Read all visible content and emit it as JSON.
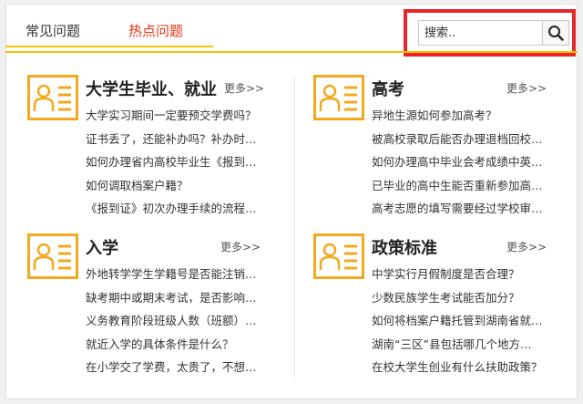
{
  "tabs": [
    {
      "label": "常见问题"
    },
    {
      "label": "热点问题"
    }
  ],
  "search": {
    "placeholder": "搜索.."
  },
  "more_label": "更多>>",
  "colors": {
    "accent_yellow": "#f5c400",
    "hot_red": "#e63212",
    "highlight_red": "#e8262a"
  },
  "sections": [
    {
      "title": "大学生毕业、就业",
      "items": [
        "大学实习期间一定要预交学费吗？",
        "证书丢了，还能补办吗？补办时…",
        "如何办理省内高校毕业生《报到…",
        "如何调取档案户籍？",
        "《报到证》初次办理手续的流程…"
      ]
    },
    {
      "title": "高考",
      "items": [
        "异地生源如何参加高考？",
        "被高校录取后能否办理退档回校…",
        "如何办理高中毕业会考成绩中英…",
        "已毕业的高中生能否重新参加高…",
        "高考志愿的填写需要经过学校审…"
      ]
    },
    {
      "title": "入学",
      "items": [
        "外地转学学生学籍号是否能注销…",
        "缺考期中或期末考试，是否影响…",
        "义务教育阶段班级人数（班额）…",
        "就近入学的具体条件是什么？",
        "在小学交了学费，太贵了，不想…"
      ]
    },
    {
      "title": "政策标准",
      "items": [
        "中学实行月假制度是否合理？",
        "少数民族学生考试能否加分？",
        "如何将档案户籍托管到湖南省就…",
        "湖南“三区”县包括哪几个地方…",
        "在校大学生创业有什么扶助政策？"
      ]
    }
  ]
}
